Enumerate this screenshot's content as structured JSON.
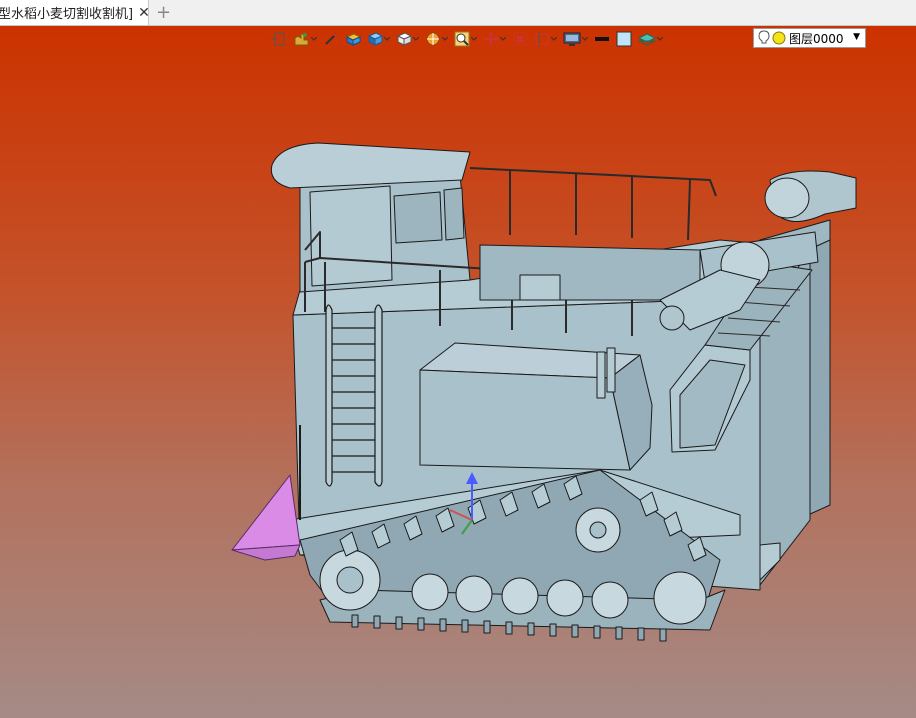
{
  "tabs": {
    "active_tab_label": "型水稻小麦切割收割机]",
    "close_symbol": "✕",
    "add_symbol": "+"
  },
  "toolbar": {
    "tools": [
      {
        "name": "view-frame-icon",
        "has_dropdown": false
      },
      {
        "name": "tree-hand-icon",
        "has_dropdown": true
      },
      {
        "name": "pencil-icon",
        "has_dropdown": false
      },
      {
        "name": "solid-shade-icon",
        "has_dropdown": false
      },
      {
        "name": "cube-blue-icon",
        "has_dropdown": true
      },
      {
        "name": "cube-white-icon",
        "has_dropdown": true
      },
      {
        "name": "section-icon",
        "has_dropdown": true
      },
      {
        "name": "zoom-icon",
        "has_dropdown": true
      },
      {
        "name": "pan-icon",
        "has_dropdown": true
      },
      {
        "name": "zoom-area-icon",
        "has_dropdown": false
      },
      {
        "name": "fit-icon",
        "has_dropdown": true
      },
      {
        "name": "display-icon",
        "has_dropdown": true
      },
      {
        "name": "line-color-icon",
        "has_dropdown": false
      },
      {
        "name": "fill-color-icon",
        "has_dropdown": false
      },
      {
        "name": "layer-stack-icon",
        "has_dropdown": true
      }
    ],
    "layer_select": {
      "value": "图层0000",
      "icons": [
        "bulb-icon",
        "yellow-dot-icon"
      ],
      "dropdown_symbol": "▼"
    }
  },
  "viewport": {
    "background_top": "#cc3200",
    "background_bottom": "#a58a86",
    "model_color": "#a9c1cb",
    "accent_color": "#d98be6"
  }
}
